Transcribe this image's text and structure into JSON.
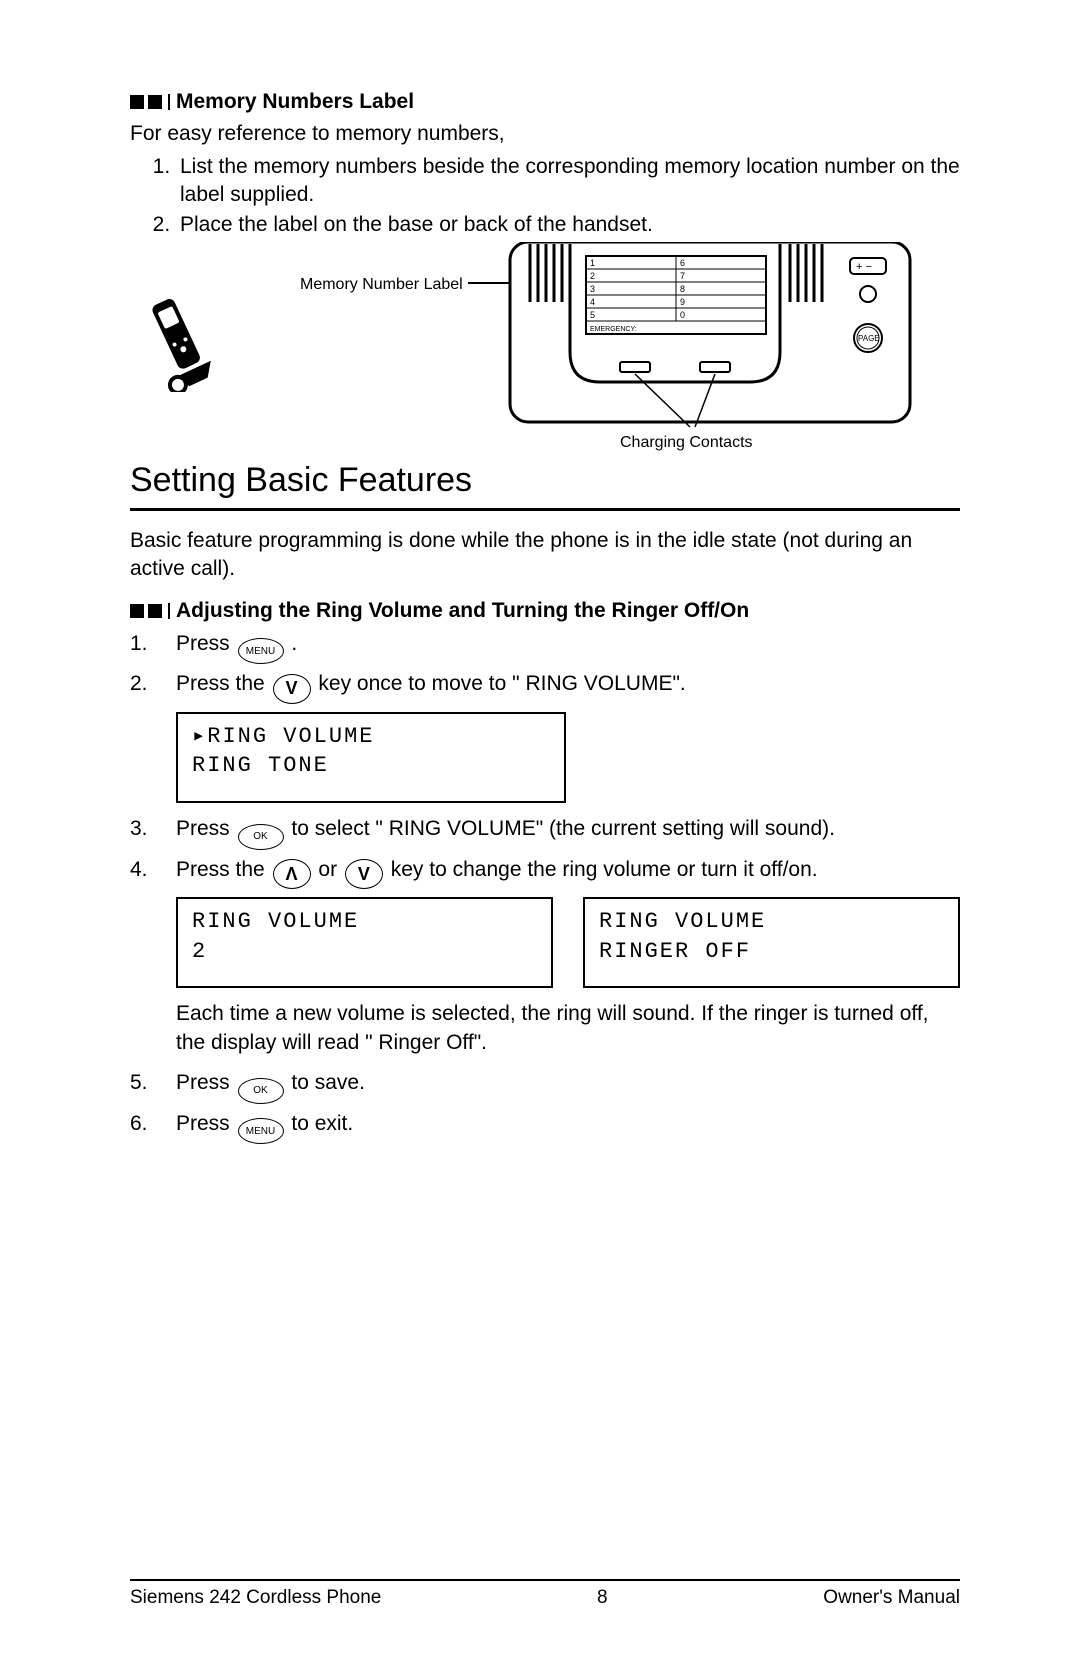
{
  "sec1": {
    "title": "Memory Numbers Label",
    "intro": "For easy reference to memory numbers,",
    "steps": [
      "List the memory numbers beside the corresponding memory location number on the label supplied.",
      "Place the label on the base or back of the handset."
    ],
    "fig_label_mem": "Memory Number Label",
    "fig_label_cc": "Charging Contacts",
    "mem_left": [
      "1",
      "2",
      "3",
      "4",
      "5"
    ],
    "mem_right": [
      "6",
      "7",
      "8",
      "9",
      "0"
    ],
    "mem_emergency": "EMERGENCY:",
    "page_btn": "PAGE"
  },
  "sec2": {
    "title": "Setting Basic Features",
    "intro": "Basic feature programming is done while the phone is in the idle state (not during an active call).",
    "sub": "Adjusting the Ring Volume and Turning the Ringer Off/On",
    "step1_a": "Press ",
    "step1_b": " .",
    "step2_a": "Press the ",
    "step2_b": " key once to move to \" RING VOLUME\".",
    "lcd1_l1": "▸RING VOLUME",
    "lcd1_l2": " RING TONE",
    "step3_a": "Press ",
    "step3_b": " to select \" RING VOLUME\" (the current setting will sound).",
    "step4_a": "Press the ",
    "step4_mid": "  or  ",
    "step4_b": " key to change the ring volume or turn it off/on.",
    "lcd2a_l1": " RING VOLUME",
    "lcd2a_l2": " 2",
    "lcd2b_l1": " RING VOLUME",
    "lcd2b_l2": " RINGER OFF",
    "note": "Each time a new volume is selected, the ring will sound. If the ringer is turned off, the display will read \" Ringer Off\".",
    "step5_a": "Press ",
    "step5_b": " to save.",
    "step6_a": "Press ",
    "step6_b": " to exit."
  },
  "keys": {
    "menu": "MENU",
    "ok": "OK",
    "down": "V",
    "up": "Λ"
  },
  "footer": {
    "left": "Siemens 242 Cordless Phone",
    "center": "8",
    "right": "Owner's Manual"
  }
}
